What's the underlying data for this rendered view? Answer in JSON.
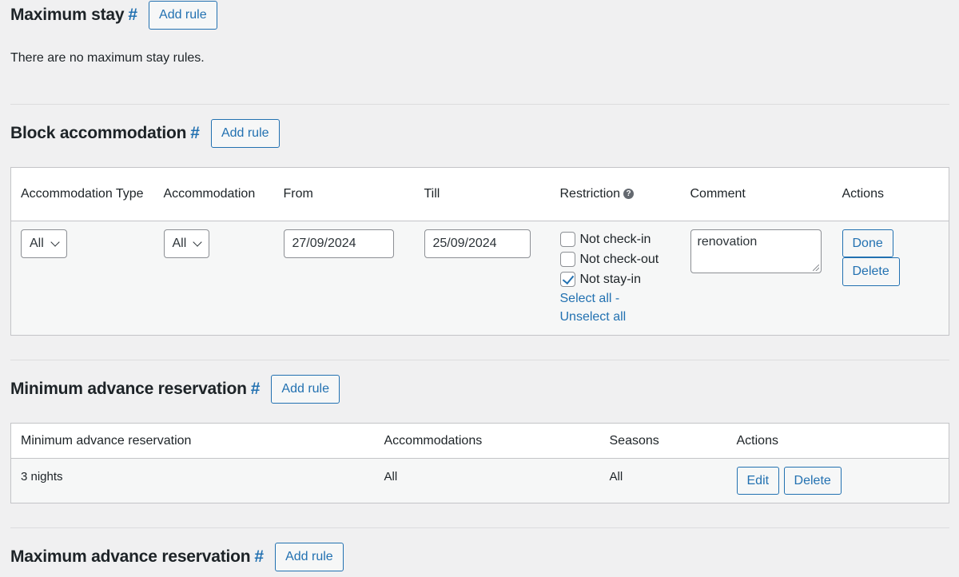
{
  "sections": {
    "max_stay": {
      "title": "Maximum stay",
      "hash": "#",
      "add_rule": "Add rule",
      "empty_text": "There are no maximum stay rules."
    },
    "block": {
      "title": "Block accommodation",
      "hash": "#",
      "add_rule": "Add rule",
      "headers": {
        "type": "Accommodation Type",
        "accommodation": "Accommodation",
        "from": "From",
        "till": "Till",
        "restriction": "Restriction",
        "restriction_help": "?",
        "comment": "Comment",
        "actions": "Actions"
      },
      "row": {
        "type_value": "All",
        "accommodation_value": "All",
        "from_value": "27/09/2024",
        "till_value": "25/09/2024",
        "restrictions": [
          {
            "label": "Not check-in",
            "checked": false
          },
          {
            "label": "Not check-out",
            "checked": false
          },
          {
            "label": "Not stay-in",
            "checked": true
          }
        ],
        "select_all": "Select all",
        "separator": "-",
        "unselect_all": "Unselect all",
        "comment_value": "renovation",
        "done": "Done",
        "delete": "Delete"
      }
    },
    "min_advance": {
      "title": "Minimum advance reservation",
      "hash": "#",
      "add_rule": "Add rule",
      "headers": {
        "reservation": "Minimum advance reservation",
        "accommodations": "Accommodations",
        "seasons": "Seasons",
        "actions": "Actions"
      },
      "row": {
        "reservation": "3 nights",
        "accommodations": "All",
        "seasons": "All",
        "edit": "Edit",
        "delete": "Delete"
      }
    },
    "max_advance": {
      "title": "Maximum advance reservation",
      "hash": "#",
      "add_rule": "Add rule"
    }
  },
  "colors": {
    "background": "#f0f0f1",
    "accent": "#2271b1",
    "text": "#1d2327",
    "border": "#c3c4c7"
  }
}
